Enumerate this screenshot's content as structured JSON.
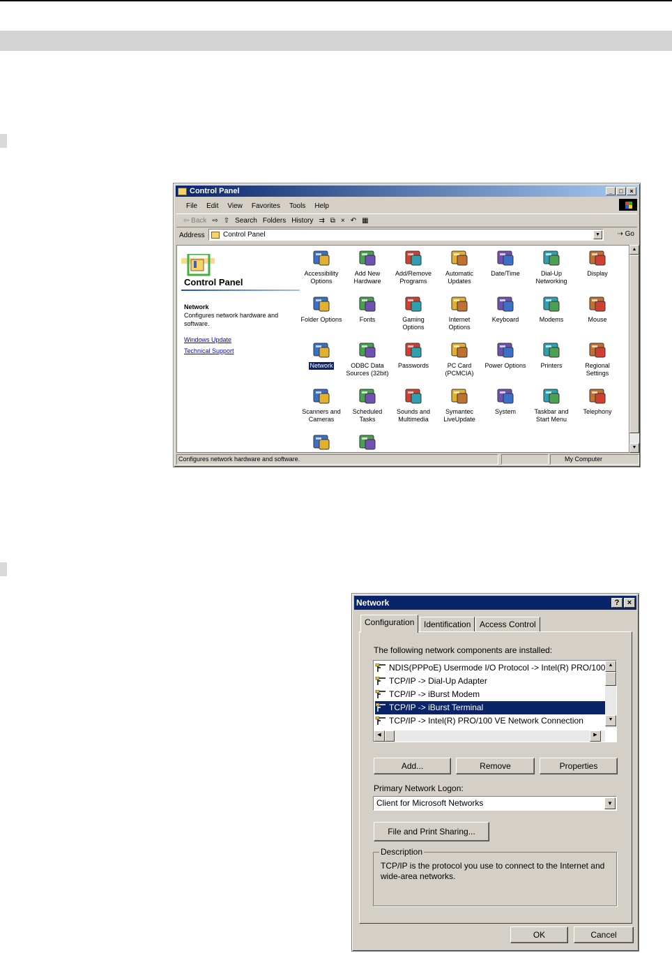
{
  "control_panel": {
    "title": "Control Panel",
    "title_buttons": {
      "minimize": "_",
      "maximize": "□",
      "close": "×"
    },
    "menu": [
      "File",
      "Edit",
      "View",
      "Favorites",
      "Tools",
      "Help"
    ],
    "toolbar": {
      "back": "⇦ Back",
      "forward": "⇨",
      "up": "⇧",
      "search": "Search",
      "folders": "Folders",
      "history": "History",
      "move": "⇉",
      "copy": "⧉",
      "delete": "×",
      "undo": "↶",
      "views": "▦"
    },
    "address_label": "Address",
    "address_value": "Control Panel",
    "go_label": "Go",
    "left_pane": {
      "heading": "Control Panel",
      "selected_name": "Network",
      "selected_desc": "Configures network hardware and software.",
      "link1": "Windows Update",
      "link2": "Technical Support"
    },
    "icons": [
      {
        "label": "Accessibility\nOptions",
        "icon": "accessibility-icon"
      },
      {
        "label": "Add New\nHardware",
        "icon": "add-hardware-icon"
      },
      {
        "label": "Add/Remove\nPrograms",
        "icon": "add-remove-programs-icon"
      },
      {
        "label": "Automatic\nUpdates",
        "icon": "automatic-updates-icon"
      },
      {
        "label": "Date/Time",
        "icon": "date-time-icon"
      },
      {
        "label": "Dial-Up\nNetworking",
        "icon": "dial-up-networking-icon"
      },
      {
        "label": "Display",
        "icon": "display-icon"
      },
      {
        "label": "Folder Options",
        "icon": "folder-options-icon"
      },
      {
        "label": "Fonts",
        "icon": "fonts-icon"
      },
      {
        "label": "Gaming\nOptions",
        "icon": "gaming-options-icon"
      },
      {
        "label": "Internet\nOptions",
        "icon": "internet-options-icon"
      },
      {
        "label": "Keyboard",
        "icon": "keyboard-icon"
      },
      {
        "label": "Modems",
        "icon": "modems-icon"
      },
      {
        "label": "Mouse",
        "icon": "mouse-icon"
      },
      {
        "label": "Network",
        "icon": "network-icon",
        "selected": true
      },
      {
        "label": "ODBC Data\nSources (32bit)",
        "icon": "odbc-icon"
      },
      {
        "label": "Passwords",
        "icon": "passwords-icon"
      },
      {
        "label": "PC Card\n(PCMCIA)",
        "icon": "pc-card-icon"
      },
      {
        "label": "Power Options",
        "icon": "power-options-icon"
      },
      {
        "label": "Printers",
        "icon": "printers-icon"
      },
      {
        "label": "Regional\nSettings",
        "icon": "regional-settings-icon"
      },
      {
        "label": "Scanners and\nCameras",
        "icon": "scanners-cameras-icon"
      },
      {
        "label": "Scheduled\nTasks",
        "icon": "scheduled-tasks-icon"
      },
      {
        "label": "Sounds and\nMultimedia",
        "icon": "sounds-icon"
      },
      {
        "label": "Symantec\nLiveUpdate",
        "icon": "liveupdate-icon"
      },
      {
        "label": "System",
        "icon": "system-icon"
      },
      {
        "label": "Taskbar and\nStart Menu",
        "icon": "taskbar-icon"
      },
      {
        "label": "Telephony",
        "icon": "telephony-icon"
      },
      {
        "label": "",
        "icon": "users-icon"
      },
      {
        "label": "",
        "icon": "infrared-icon"
      }
    ],
    "status_text": "Configures network hardware and software.",
    "status_zone": "My Computer",
    "scroll_up": "▲",
    "scroll_down": "▼"
  },
  "network_dialog": {
    "title": "Network",
    "help_btn": "?",
    "close_btn": "×",
    "tabs": [
      "Configuration",
      "Identification",
      "Access Control"
    ],
    "components_label": "The following network components are installed:",
    "components": [
      "NDIS(PPPoE) Usermode I/O Protocol -> Intel(R) PRO/100",
      "TCP/IP -> Dial-Up Adapter",
      "TCP/IP -> iBurst Modem",
      "TCP/IP -> iBurst Terminal",
      "TCP/IP -> Intel(R) PRO/100 VE Network Connection"
    ],
    "selected_component": 3,
    "add_btn": "Add...",
    "remove_btn": "Remove",
    "properties_btn": "Properties",
    "logon_label": "Primary Network Logon:",
    "logon_value": "Client for Microsoft Networks",
    "sharing_btn": "File and Print Sharing...",
    "description_label": "Description",
    "description_text": "TCP/IP is the protocol you use to connect to the Internet and wide-area networks.",
    "ok_btn": "OK",
    "cancel_btn": "Cancel",
    "arrows": {
      "up": "▲",
      "down": "▼",
      "left": "◀",
      "right": "▶",
      "dropdown": "▼"
    }
  },
  "colors": {
    "title_active": "#0a246a",
    "face": "#d4d0c8",
    "link": "#0000ee"
  }
}
